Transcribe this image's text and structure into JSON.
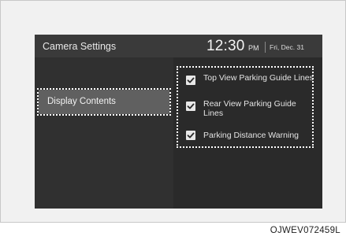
{
  "header": {
    "title": "Camera Settings",
    "time": "12:30",
    "ampm": "PM",
    "date": "Fri, Dec. 31"
  },
  "sidebar": {
    "items": [
      {
        "label": "Display Contents",
        "selected": true
      }
    ]
  },
  "options": [
    {
      "label": "Top View Parking Guide Lines",
      "checked": true
    },
    {
      "label": "Rear View Parking Guide Lines",
      "checked": true
    },
    {
      "label": "Parking Distance Warning",
      "checked": true
    }
  ],
  "caption": "OJWEV072459L",
  "colors": {
    "screen_background": "#2a2a2a",
    "header_background": "#3a3a3a",
    "selected_item": "#606060",
    "highlight_outline": "#ffffff"
  },
  "icons": {
    "checkbox": "check-icon"
  }
}
